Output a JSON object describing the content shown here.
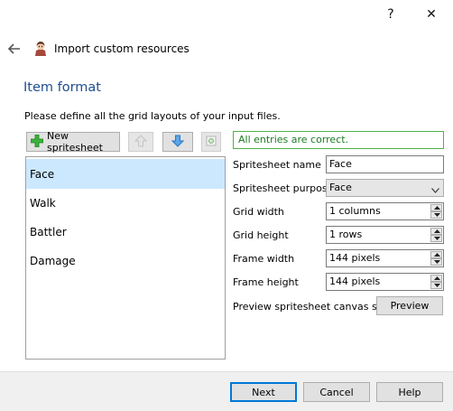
{
  "titlebar": {
    "help_glyph": "?",
    "close_glyph": "✕"
  },
  "wizard": {
    "title": "Import custom resources"
  },
  "section": {
    "title": "Item format",
    "instruction": "Please define all the grid layouts of your input files."
  },
  "toolbar": {
    "new_label": "New spritesheet",
    "icons": [
      "add-icon",
      "move-up-icon",
      "move-down-icon",
      "preview-small-icon"
    ]
  },
  "status": {
    "text": "All entries are correct.",
    "color": "#1c7a22"
  },
  "list": {
    "items": [
      {
        "label": "Face",
        "selected": true
      },
      {
        "label": "Walk",
        "selected": false
      },
      {
        "label": "Battler",
        "selected": false
      },
      {
        "label": "Damage",
        "selected": false
      }
    ]
  },
  "form": {
    "name_label": "Spritesheet name",
    "name_value": "Face",
    "purpose_label": "Spritesheet purpose",
    "purpose_value": "Face",
    "grid_width_label": "Grid width",
    "grid_width_value": "1 columns",
    "grid_height_label": "Grid height",
    "grid_height_value": "1 rows",
    "frame_width_label": "Frame width",
    "frame_width_value": "144 pixels",
    "frame_height_label": "Frame height",
    "frame_height_value": "144 pixels",
    "preview_label": "Preview spritesheet canvas size",
    "preview_button": "Preview"
  },
  "footer": {
    "next": "Next",
    "cancel": "Cancel",
    "help": "Help"
  },
  "colors": {
    "accent_title": "#1f4e8f",
    "selection": "#cce8ff",
    "status_border": "#4fb348"
  }
}
